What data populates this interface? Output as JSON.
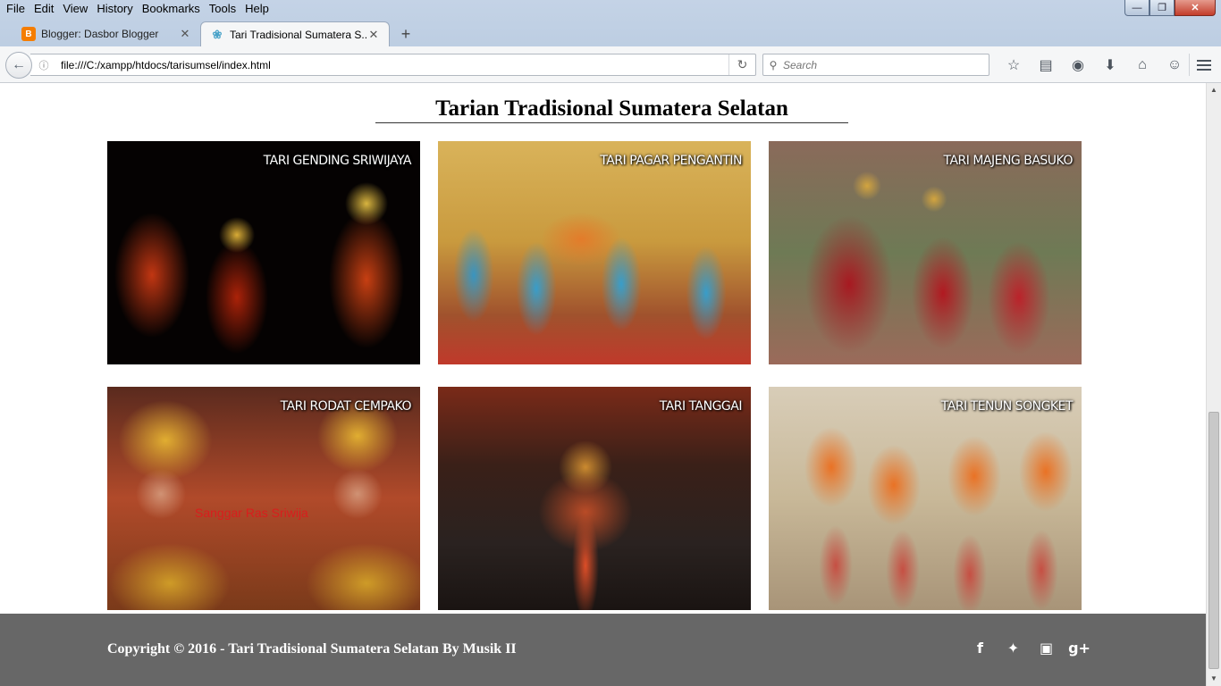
{
  "menu": {
    "file": "File",
    "edit": "Edit",
    "view": "View",
    "history": "History",
    "bookmarks": "Bookmarks",
    "tools": "Tools",
    "help": "Help"
  },
  "tabs": [
    {
      "title": "Blogger: Dasbor Blogger",
      "favicon": "blogger-icon",
      "active": false
    },
    {
      "title": "Tari Tradisional Sumatera S...",
      "favicon": "lotus-icon",
      "active": true
    }
  ],
  "address_bar": {
    "url": "file:///C:/xampp/htdocs/tarisumsel/index.html"
  },
  "search_bar": {
    "placeholder": "Search"
  },
  "page": {
    "title": "Tarian Tradisional Sumatera Selatan",
    "gallery": [
      {
        "caption": "TARI GENDING SRIWIJAYA"
      },
      {
        "caption": "TARI PAGAR PENGANTIN"
      },
      {
        "caption": "TARI MAJENG BASUKO"
      },
      {
        "caption": "TARI RODAT CEMPAKO",
        "watermark": "Sanggar Ras Sriwija"
      },
      {
        "caption": "TARI TANGGAI"
      },
      {
        "caption": "TARI TENUN SONGKET"
      }
    ],
    "footer": {
      "copyright": "Copyright © 2016 - Tari Tradisional Sumatera Selatan By Musik II",
      "social": [
        "facebook-icon",
        "twitter-icon",
        "instagram-icon",
        "google-plus-icon"
      ]
    }
  }
}
